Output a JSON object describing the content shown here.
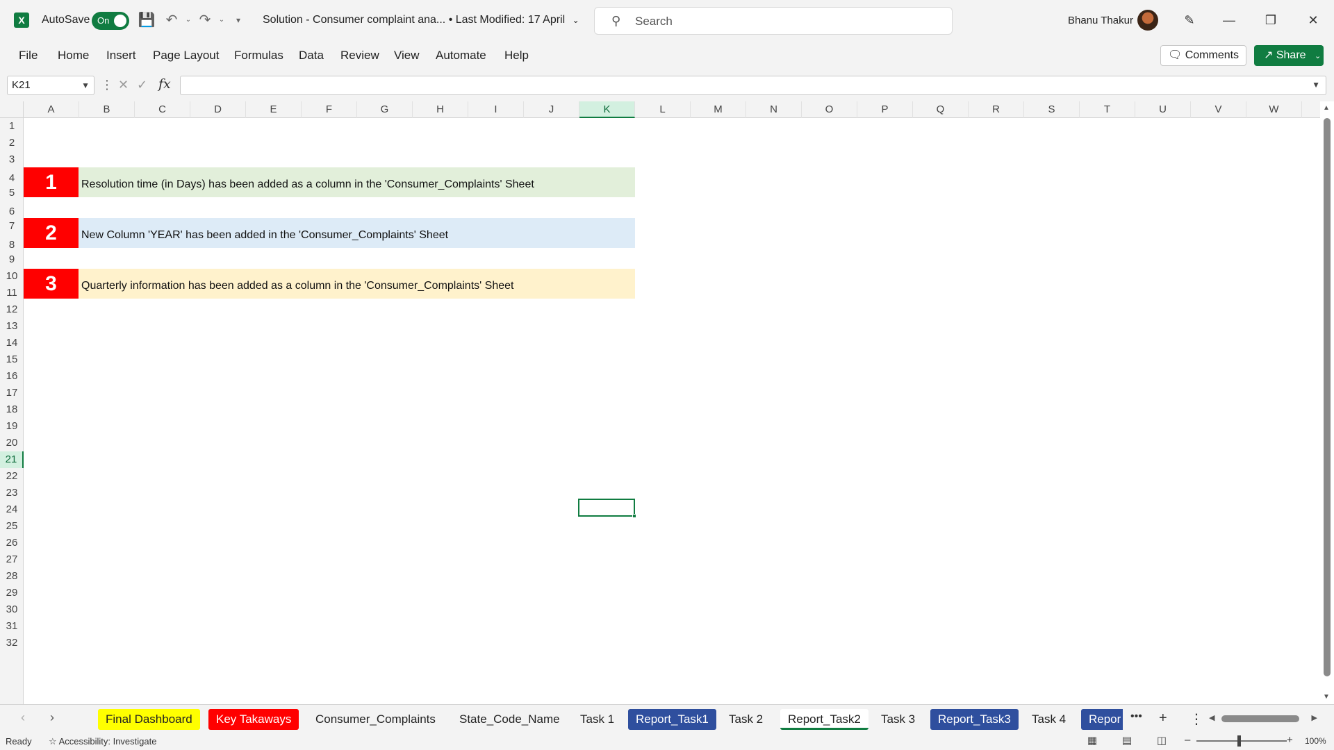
{
  "titlebar": {
    "app_logo": "X",
    "autosave_label": "AutoSave",
    "autosave_state": "On",
    "doc_title": "Solution - Consumer complaint ana...  •  Last Modified: 17 April",
    "search_placeholder": "Search",
    "user_name": "Bhanu Thakur"
  },
  "menu": {
    "items": [
      "File",
      "Home",
      "Insert",
      "Page Layout",
      "Formulas",
      "Data",
      "Review",
      "View",
      "Automate",
      "Help"
    ],
    "comments_label": "Comments",
    "share_label": "Share"
  },
  "formula_bar": {
    "name_box": "K21",
    "fx_label": "fx",
    "formula": ""
  },
  "grid": {
    "columns": [
      "A",
      "B",
      "C",
      "D",
      "E",
      "F",
      "G",
      "H",
      "I",
      "J",
      "K",
      "L",
      "M",
      "N",
      "O",
      "P",
      "Q",
      "R",
      "S",
      "T",
      "U",
      "V",
      "W"
    ],
    "selected_column": "K",
    "selected_row": 21,
    "row_count": 32,
    "banners": [
      {
        "number": "1",
        "text": "Resolution time (in Days) has been added as a column in the 'Consumer_Complaints' Sheet",
        "color": "#e2efda"
      },
      {
        "number": "2",
        "text": "New Column 'YEAR' has been added in the 'Consumer_Complaints' Sheet",
        "color": "#ddebf7"
      },
      {
        "number": "3",
        "text": "Quarterly information has been added as a column in the 'Consumer_Complaints' Sheet",
        "color": "#fff2cc"
      }
    ],
    "accent_color": "#ff0000"
  },
  "sheet_tabs": [
    {
      "label": "Final Dashboard",
      "bg": "#ffff00",
      "fg": "#222222"
    },
    {
      "label": "Key Takaways",
      "bg": "#ff0000",
      "fg": "#ffffff"
    },
    {
      "label": "Consumer_Complaints",
      "bg": "",
      "fg": "#222222"
    },
    {
      "label": "State_Code_Name",
      "bg": "",
      "fg": "#222222"
    },
    {
      "label": "Task 1",
      "bg": "",
      "fg": "#222222"
    },
    {
      "label": "Report_Task1",
      "bg": "#2f4f9e",
      "fg": "#ffffff"
    },
    {
      "label": "Task 2",
      "bg": "",
      "fg": "#222222"
    },
    {
      "label": "Report_Task2",
      "bg": "",
      "fg": "#222222",
      "active": true
    },
    {
      "label": "Task 3",
      "bg": "",
      "fg": "#222222"
    },
    {
      "label": "Report_Task3",
      "bg": "#2f4f9e",
      "fg": "#ffffff"
    },
    {
      "label": "Task 4",
      "bg": "",
      "fg": "#222222"
    },
    {
      "label": "Repor",
      "bg": "#2f4f9e",
      "fg": "#ffffff"
    }
  ],
  "status": {
    "ready": "Ready",
    "accessibility": "Accessibility: Investigate",
    "zoom": "100%"
  }
}
